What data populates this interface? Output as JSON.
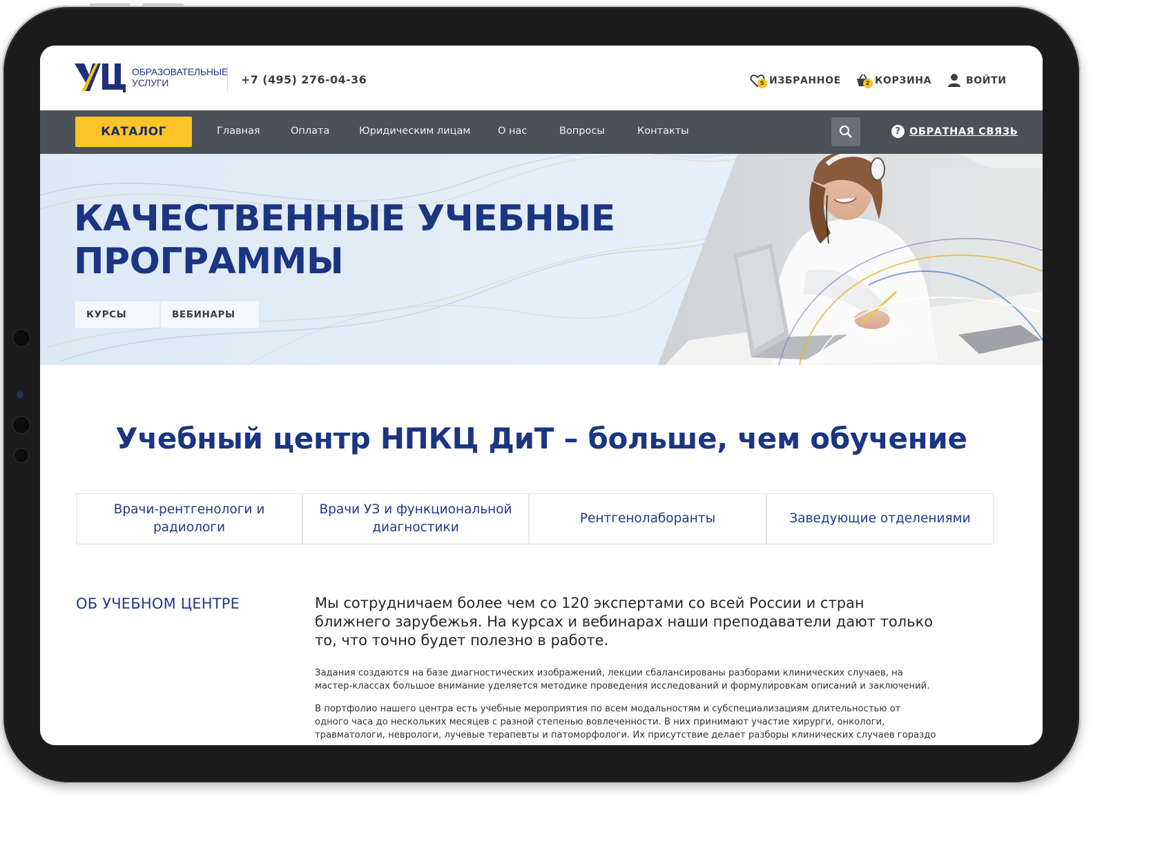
{
  "brand": {
    "logo_mark": "УЦ",
    "logo_line1": "ОБРАЗОВАТЕЛЬНЫЕ",
    "logo_line2": "УСЛУГИ",
    "phone": "+7 (495) 276-04-36",
    "accent_blue": "#1b3582",
    "accent_yellow": "#fbc52a"
  },
  "header": {
    "favorites": {
      "label": "ИЗБРАННОЕ",
      "count": "5",
      "icon": "heart-icon"
    },
    "cart": {
      "label": "КОРЗИНА",
      "count": "2",
      "icon": "cart-icon"
    },
    "login": {
      "label": "ВОЙТИ",
      "icon": "user-icon"
    }
  },
  "nav": {
    "catalog": "КАТАЛОГ",
    "items": [
      "Главная",
      "Оплата",
      "Юридическим лицам",
      "О нас",
      "Вопросы",
      "Контакты"
    ],
    "search_icon": "search-icon",
    "feedback": "ОБРАТНАЯ СВЯЗЬ",
    "feedback_icon": "question-circle-icon"
  },
  "hero": {
    "title_line1": "КАЧЕСТВЕННЫЕ УЧЕБНЫЕ",
    "title_line2": "ПРОГРАММЫ",
    "tabs": [
      "КУРСЫ",
      "ВЕБИНАРЫ"
    ]
  },
  "main": {
    "title": "Учебный центр НПКЦ ДиТ – больше, чем обучение",
    "categories": [
      "Врачи-рентгенологи и радиологи",
      "Врачи УЗ и функциональной диагностики",
      "Рентгенолаборанты",
      "Заведующие отделениями"
    ]
  },
  "about": {
    "title": "ОБ УЧЕБНОМ ЦЕНТРЕ",
    "lead": "Мы сотрудничаем более чем со 120 экспертами со всей России и стран ближнего зарубежья. На курсах и вебинарах наши преподаватели дают только то, что точно будет полезно в работе.",
    "p1": "Задания создаются на базе диагностических изображений, лекции сбалансированы разборами клинических случаев, на мастер-классах большое внимание уделяется методике проведения исследований и формулировкам описаний и заключений.",
    "p2": "В портфолио нашего центра есть учебные мероприятия по всем модальностям и субспециализациям длительностью от одного часа до нескольких месяцев с разной степенью вовлеченности. В них принимают участие хирурги, онкологи, травматологи, неврологи, лучевые терапевты и патоморфологи. Их присутствие делает разборы клинических случаев гораздо интереснее, это"
  }
}
